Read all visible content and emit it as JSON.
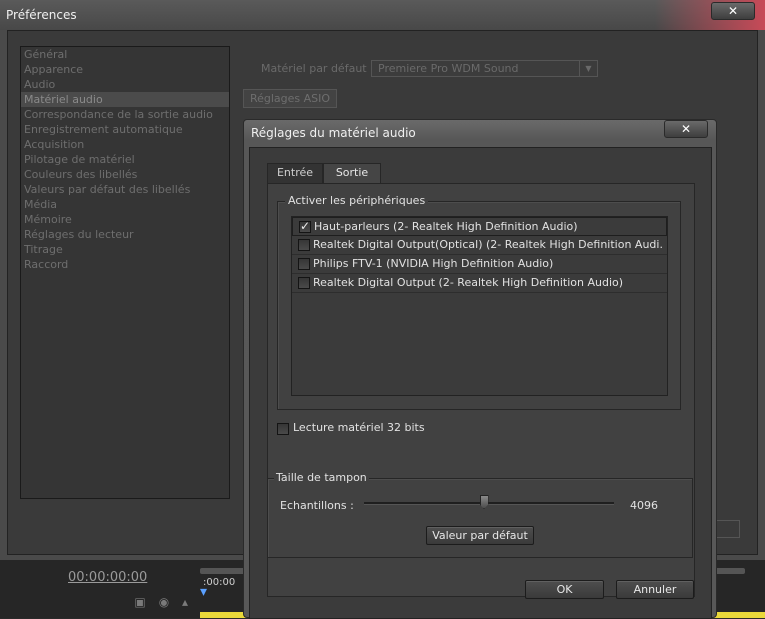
{
  "preferences": {
    "title": "Préférences",
    "close_glyph": "✕",
    "categories": [
      "Général",
      "Apparence",
      "Audio",
      "Matériel audio",
      "Correspondance de la sortie audio",
      "Enregistrement automatique",
      "Acquisition",
      "Pilotage de matériel",
      "Couleurs des libellés",
      "Valeurs par défaut des libellés",
      "Média",
      "Mémoire",
      "Réglages du lecteur",
      "Titrage",
      "Raccord"
    ],
    "selected_category": "Matériel audio",
    "default_material_label": "Matériel par défaut :",
    "default_material_value": "Premiere Pro WDM Sound",
    "asio_button": "Réglages ASIO"
  },
  "timeline": {
    "timecode": "00:00:00:00",
    "ruler_time": ":00:00"
  },
  "dialog": {
    "title": "Réglages du matériel audio",
    "close_glyph": "✕",
    "tabs": [
      "Entrée",
      "Sortie"
    ],
    "active_tab": "Sortie",
    "devices_group_title": "Activer les périphériques",
    "devices": [
      {
        "label": "Haut-parleurs (2- Realtek High Definition Audio)",
        "checked": true
      },
      {
        "label": "Realtek Digital Output(Optical) (2- Realtek High Definition Audi.",
        "checked": false
      },
      {
        "label": "Philips FTV-1 (NVIDIA High Definition Audio)",
        "checked": false
      },
      {
        "label": "Realtek Digital Output (2- Realtek High Definition Audio)",
        "checked": false
      }
    ],
    "bit32_label": "Lecture matériel 32 bits",
    "bit32_checked": false,
    "buffer_title": "Taille de tampon",
    "samples_label": "Echantillons :",
    "samples_value": "4096",
    "samples_slider_fraction": 0.48,
    "default_button": "Valeur par défaut",
    "ok_button": "OK",
    "cancel_button": "Annuler"
  }
}
